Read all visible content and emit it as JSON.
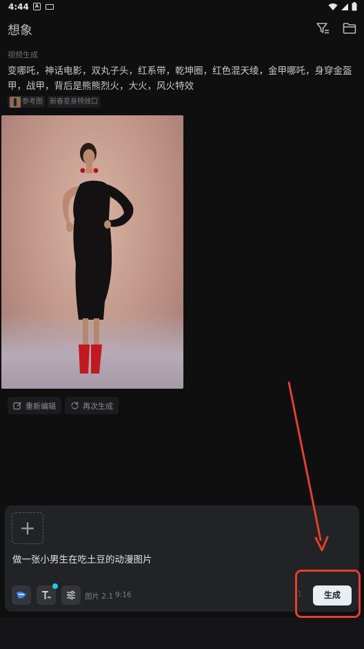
{
  "status": {
    "time": "4:44",
    "a_icon": "A"
  },
  "header": {
    "title": "想象",
    "filter_icon": "filter-icon",
    "folder_icon": "folder-icon"
  },
  "result": {
    "section_label": "视频生成",
    "prompt": "变哪吒，神话电影，双丸子头，红系带，乾坤圈，红色混天绫，金甲哪吒，身穿金盔甲，战甲，背后是熊熊烈火，大火，风火特效",
    "tags": {
      "reference": "参考图",
      "effect": "新春变身特效口"
    },
    "actions": {
      "reedit": "重新编辑",
      "regenerate": "再次生成"
    }
  },
  "composer": {
    "add_label": "+",
    "input_text": "做一张小男生在吃土豆的动漫图片",
    "mode_label": "图片 2.1",
    "ratio_label": "9:16",
    "count_label": "1",
    "generate_label": "生成"
  },
  "colors": {
    "background": "#0f0f10",
    "composer_bg": "#212327",
    "generate_bg": "#e9eef2",
    "annotation_red": "#e3402e",
    "accent_cyan": "#29c4e0"
  }
}
